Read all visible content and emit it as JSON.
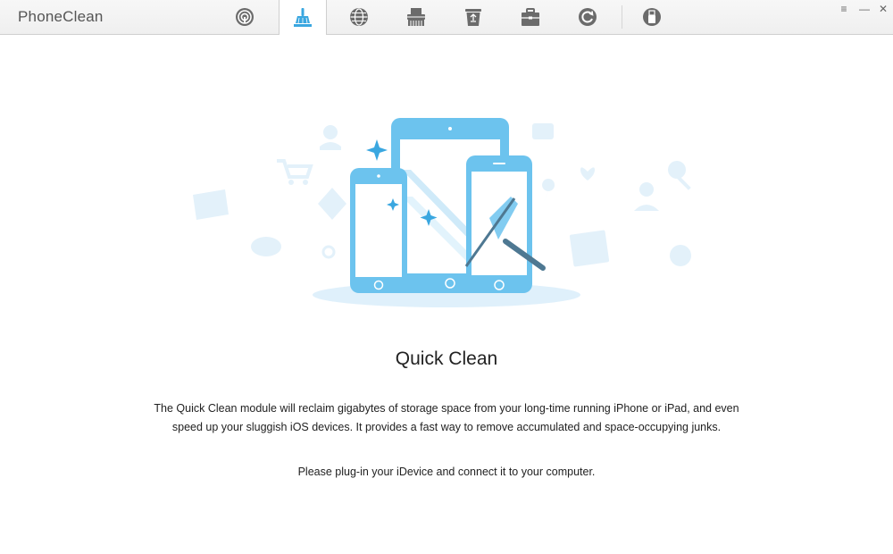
{
  "app": {
    "title": "PhoneClean"
  },
  "toolbar": {
    "tabs": [
      {
        "icon": "phone-scan-icon",
        "active": false
      },
      {
        "icon": "broom-icon",
        "active": true
      },
      {
        "icon": "globe-icon",
        "active": false
      },
      {
        "icon": "shredder-icon",
        "active": false
      },
      {
        "icon": "recycle-bin-icon",
        "active": false
      },
      {
        "icon": "toolbox-icon",
        "active": false
      },
      {
        "icon": "restore-icon",
        "active": false
      },
      {
        "icon": "usb-icon",
        "active": false
      }
    ]
  },
  "window_controls": {
    "menu": "≡",
    "minimize": "—",
    "close": "✕"
  },
  "colors": {
    "accent": "#3aa7e0",
    "icon_gray": "#6b6b6b",
    "device_blue": "#6cc3ee",
    "background_icons": "#e3f1fa"
  },
  "main": {
    "heading": "Quick Clean",
    "description": "The Quick Clean module will reclaim gigabytes of storage space from your long-time running iPhone or iPad, and even speed up your sluggish iOS devices. It provides a fast way to remove accumulated and space-occupying junks.",
    "hint": "Please plug-in your iDevice and connect it to your computer."
  }
}
